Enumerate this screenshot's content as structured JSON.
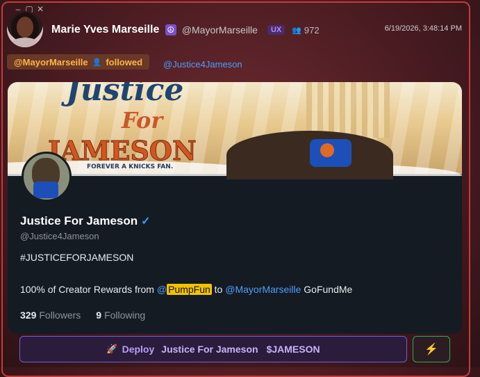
{
  "post": {
    "display_name": "Marie Yves Marseille ",
    "handle": "@MayorMarseille",
    "badge": "UX",
    "follower_count": "972",
    "timestamp": "6/19/2026, 3:48:14 PM"
  },
  "event": {
    "actor": "@MayorMarseille",
    "verb": "followed",
    "target": "@Justice4Jameson"
  },
  "banner": {
    "line1": "Justice",
    "line2": "For",
    "line3": "JAMESON",
    "tagline": "FOREVER A KNICKS FAN."
  },
  "profile": {
    "name": "Justice For Jameson",
    "verified": "✓",
    "handle": "@Justice4Jameson",
    "bio_line1": "#JUSTICEFORJAMESON",
    "bio_line2_prefix": "100% of Creator Rewards from ",
    "bio_line2_at": "@",
    "bio_line2_highlight": "PumpFun",
    "bio_line2_mid": " to ",
    "bio_line2_mention": "@MayorMarseille",
    "bio_line2_suffix": " GoFundMe",
    "followers_count": "329",
    "followers_label": "Followers",
    "following_count": "9",
    "following_label": "Following"
  },
  "actions": {
    "deploy_label": "Deploy",
    "deploy_name": "Justice For Jameson",
    "deploy_ticker": "$JAMESON",
    "bolt_icon": "⚡"
  },
  "colors": {
    "accent_purple": "#b99cff",
    "link_blue": "#4aa0ff",
    "highlight_yellow": "#f2c200",
    "follow_orange": "#ffb44a"
  }
}
